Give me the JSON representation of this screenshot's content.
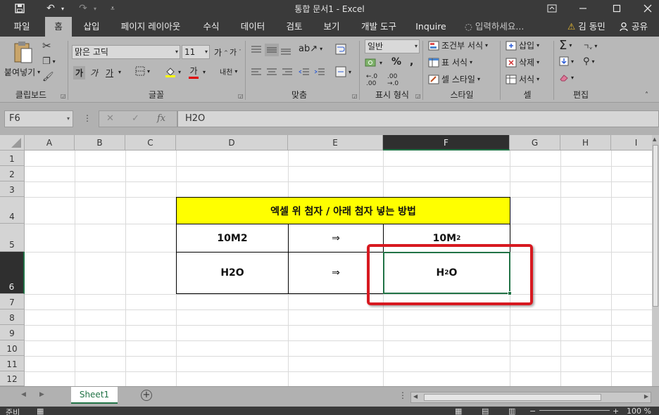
{
  "window": {
    "title": "통합 문서1 - Excel"
  },
  "tabs": [
    {
      "label": "파일"
    },
    {
      "label": "홈"
    },
    {
      "label": "삽입"
    },
    {
      "label": "페이지 레이아웃"
    },
    {
      "label": "수식"
    },
    {
      "label": "데이터"
    },
    {
      "label": "검토"
    },
    {
      "label": "보기"
    },
    {
      "label": "개발 도구"
    },
    {
      "label": "Inquire"
    }
  ],
  "tell_me": "입력하세요...",
  "user": "김 동민",
  "share": "공유",
  "ribbon": {
    "paste": "붙여넣기",
    "font_name": "맑은 고딕",
    "font_size": "11",
    "bold": "가",
    "italic": "가",
    "underline": "가",
    "font_color_glyph": "가",
    "phonetic": "내천",
    "number_format": "일반",
    "percent": "%",
    "comma": ",",
    "conditional_format": "조건부 서식",
    "table_format": "표 서식",
    "cell_style": "셀 스타일",
    "insert": "삽입",
    "delete": "삭제",
    "format": "서식",
    "groups": {
      "clipboard": "클립보드",
      "font": "글꼴",
      "alignment": "맞춤",
      "number": "표시 형식",
      "styles": "스타일",
      "cells": "셀",
      "editing": "편집"
    }
  },
  "formula_bar": {
    "name_box": "F6",
    "fx": "fx",
    "content": "H2O"
  },
  "columns": [
    "A",
    "B",
    "C",
    "D",
    "E",
    "F",
    "G",
    "H",
    "I"
  ],
  "rows": [
    "1",
    "2",
    "3",
    "4",
    "5",
    "6",
    "7",
    "8",
    "9",
    "10",
    "11",
    "12"
  ],
  "table": {
    "title": "엑셀 위 첨자 / 아래 첨자 넣는 방법",
    "row5": {
      "input": "10M2",
      "arrow": "⇒",
      "base": "10M",
      "sup": "2"
    },
    "row6": {
      "input": "H2O",
      "arrow": "⇒",
      "pre": "H",
      "sub": "2",
      "post": "O"
    }
  },
  "sheet_tab": "Sheet1",
  "status": {
    "ready": "준비",
    "zoom": "100 %"
  },
  "colors": {
    "title_fill": "#ffff00",
    "highlight": "#d71920",
    "selection": "#217346"
  }
}
